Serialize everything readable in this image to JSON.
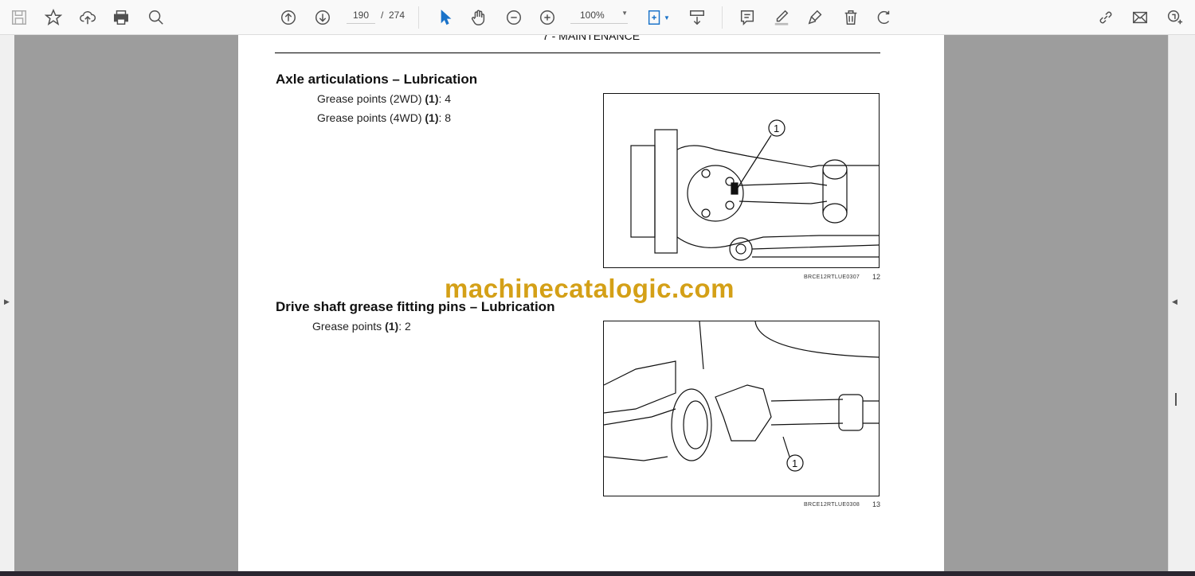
{
  "toolbar": {
    "left_icons": [
      "save-icon",
      "bookmark-star-icon",
      "upload-cloud-icon",
      "print-icon",
      "find-icon"
    ],
    "page_current": "190",
    "page_separator": "/",
    "page_total": "274",
    "zoom": "100%",
    "colors": {
      "accent": "#1a73c9",
      "viewer_bg": "#9d9d9d"
    }
  },
  "document": {
    "header": "7 - MAINTENANCE",
    "section1": {
      "title": "Axle articulations – Lubrication",
      "lines": [
        {
          "label": "Grease points (2WD) ",
          "ref": "(1)",
          "value": ": 4"
        },
        {
          "label": "Grease points (4WD) ",
          "ref": "(1)",
          "value": ": 8"
        }
      ],
      "figure_code": "BRCE12RTLUE0307",
      "figure_number": "12",
      "callout": "1"
    },
    "section2": {
      "title": "Drive shaft grease fitting pins – Lubrication",
      "lines": [
        {
          "label": "Grease points ",
          "ref": "(1)",
          "value": ": 2"
        }
      ],
      "figure_code": "BRCE12RTLUE0308",
      "figure_number": "13",
      "callout": "1"
    },
    "watermark": "machinecatalogic.com"
  }
}
